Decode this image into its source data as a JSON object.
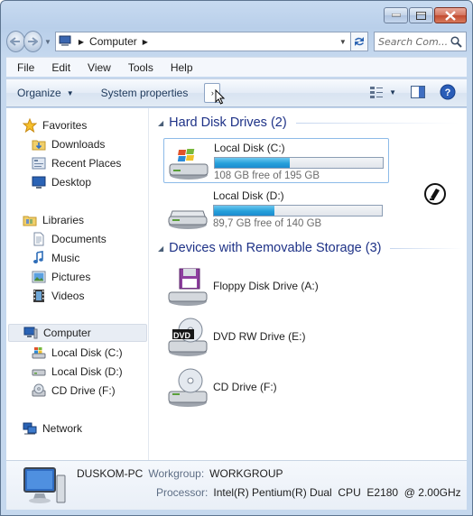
{
  "window": {
    "caption_buttons": [
      "minimize",
      "maximize",
      "close"
    ]
  },
  "address_bar": {
    "crumb": "Computer",
    "search_placeholder": "Search Com..."
  },
  "menu": [
    "File",
    "Edit",
    "View",
    "Tools",
    "Help"
  ],
  "toolbar": {
    "organize": "Organize",
    "system_properties": "System properties"
  },
  "nav": {
    "favorites": "Favorites",
    "downloads": "Downloads",
    "recent_places": "Recent Places",
    "desktop": "Desktop",
    "libraries": "Libraries",
    "documents": "Documents",
    "music": "Music",
    "pictures": "Pictures",
    "videos": "Videos",
    "computer": "Computer",
    "local_c": "Local Disk (C:)",
    "local_d": "Local Disk (D:)",
    "cd_f": "CD Drive (F:)",
    "network": "Network"
  },
  "groups": {
    "hdd_title": "Hard Disk Drives (2)",
    "removable_title": "Devices with Removable Storage (3)"
  },
  "drives": [
    {
      "name": "Local Disk (C:)",
      "free": "108 GB free of 195 GB",
      "used_fraction": 0.446
    },
    {
      "name": "Local Disk (D:)",
      "free": "89,7 GB free of 140 GB",
      "used_fraction": 0.36
    }
  ],
  "devices": [
    {
      "name": "Floppy Disk Drive (A:)"
    },
    {
      "name": "DVD RW Drive (E:)",
      "badge": "DVD"
    },
    {
      "name": "CD Drive (F:)"
    }
  ],
  "details": {
    "pc_name": "DUSKOM-PC",
    "workgroup_label": "Workgroup:",
    "workgroup": "WORKGROUP",
    "processor_label": "Processor:",
    "processor": "Intel(R) Pentium(R) Dual  CPU  E2180  @ 2.00GHz"
  },
  "colors": {
    "bar_fill": "#26a0da",
    "group_header": "#1e3287",
    "window_frame": "#b9cfea"
  }
}
